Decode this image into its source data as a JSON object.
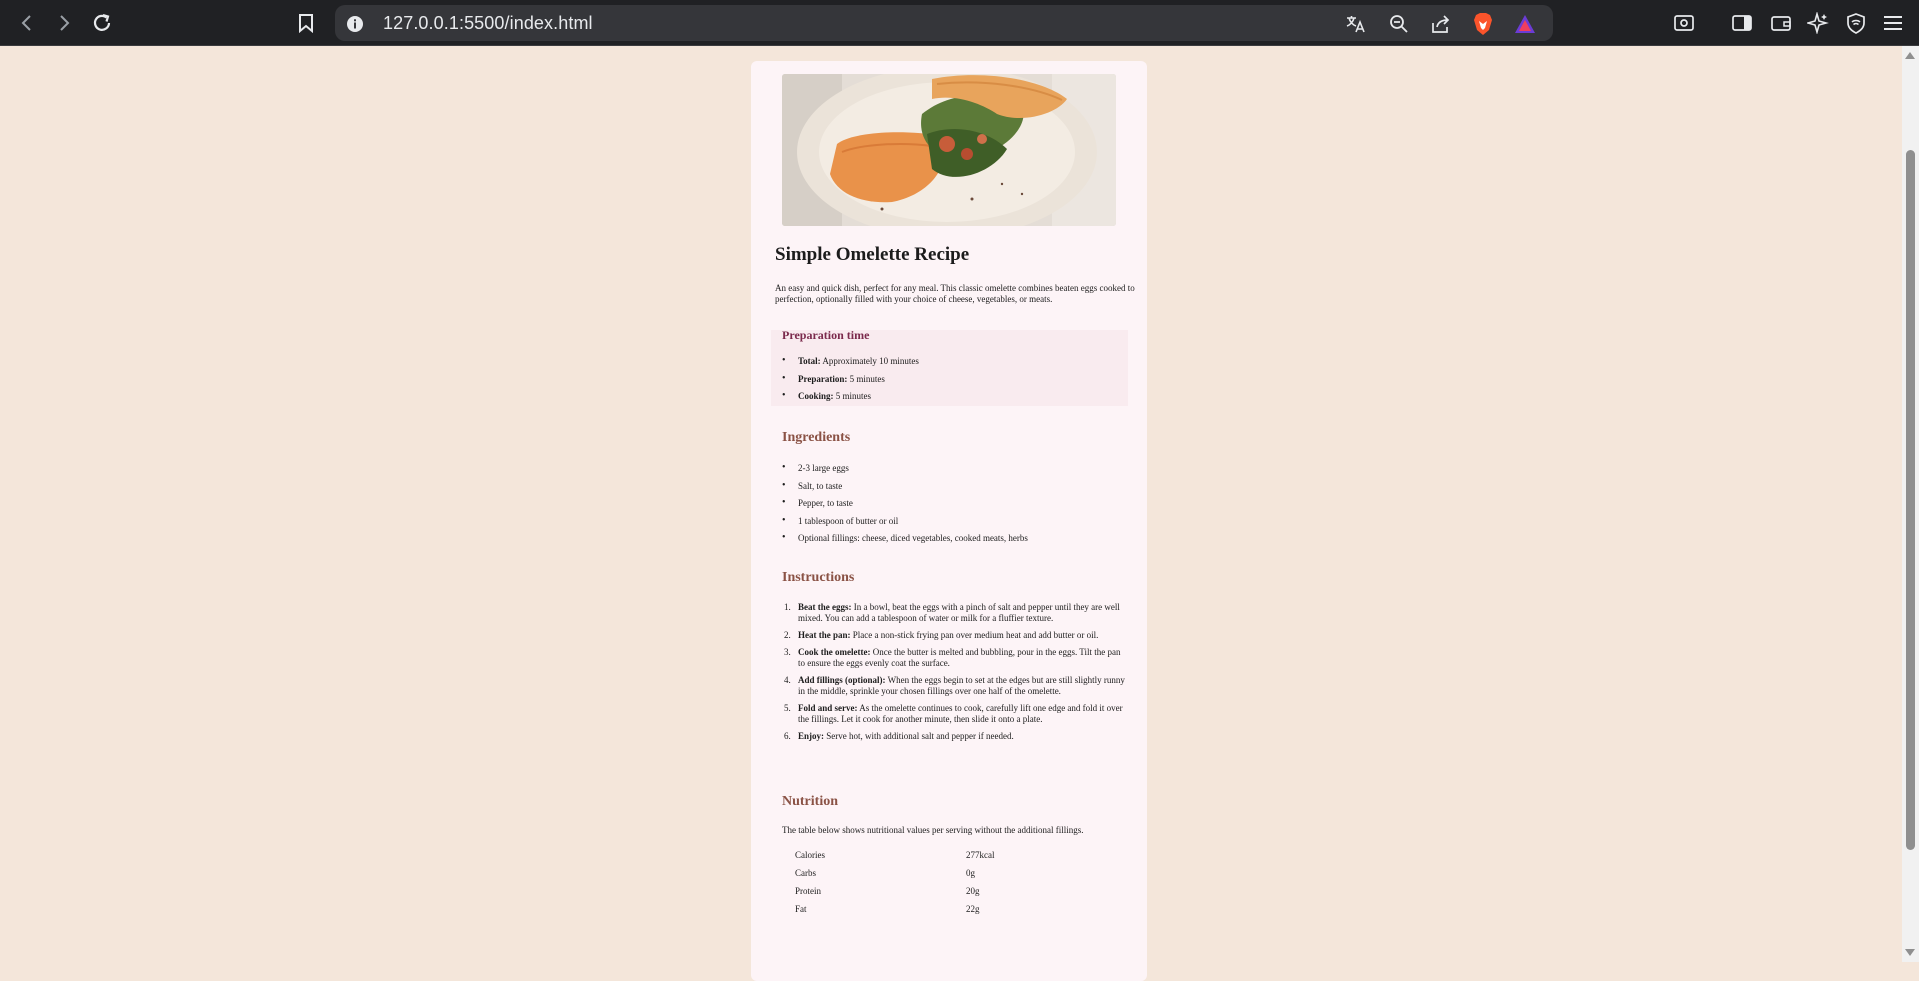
{
  "browser": {
    "url": "127.0.0.1:5500/index.html"
  },
  "recipe": {
    "title": "Simple Omelette Recipe",
    "intro": "An easy and quick dish, perfect for any meal. This classic omelette combines beaten eggs cooked to perfection, optionally filled with your choice of cheese, vegetables, or meats.",
    "prep": {
      "heading": "Preparation time",
      "items": [
        {
          "label": "Total:",
          "value": " Approximately 10 minutes"
        },
        {
          "label": "Preparation:",
          "value": " 5 minutes"
        },
        {
          "label": "Cooking:",
          "value": " 5 minutes"
        }
      ]
    },
    "ingredients": {
      "heading": "Ingredients",
      "items": [
        "2-3 large eggs",
        "Salt, to taste",
        "Pepper, to taste",
        "1 tablespoon of butter or oil",
        "Optional fillings: cheese, diced vegetables, cooked meats, herbs"
      ]
    },
    "instructions": {
      "heading": "Instructions",
      "steps": [
        {
          "num": "1.",
          "label": "Beat the eggs:",
          "text": " In a bowl, beat the eggs with a pinch of salt and pepper until they are well mixed. You can add a tablespoon of water or milk for a fluffier texture."
        },
        {
          "num": "2.",
          "label": "Heat the pan:",
          "text": " Place a non-stick frying pan over medium heat and add butter or oil."
        },
        {
          "num": "3.",
          "label": "Cook the omelette:",
          "text": " Once the butter is melted and bubbling, pour in the eggs. Tilt the pan to ensure the eggs evenly coat the surface."
        },
        {
          "num": "4.",
          "label": "Add fillings (optional):",
          "text": " When the eggs begin to set at the edges but are still slightly runny in the middle, sprinkle your chosen fillings over one half of the omelette."
        },
        {
          "num": "5.",
          "label": "Fold and serve:",
          "text": " As the omelette continues to cook, carefully lift one edge and fold it over the fillings. Let it cook for another minute, then slide it onto a plate."
        },
        {
          "num": "6.",
          "label": "Enjoy:",
          "text": " Serve hot, with additional salt and pepper if needed."
        }
      ]
    },
    "nutrition": {
      "heading": "Nutrition",
      "text": "The table below shows nutritional values per serving without the additional fillings.",
      "rows": [
        {
          "name": "Calories",
          "value": "277kcal"
        },
        {
          "name": "Carbs",
          "value": "0g"
        },
        {
          "name": "Protein",
          "value": "20g"
        },
        {
          "name": "Fat",
          "value": "22g"
        }
      ]
    }
  },
  "icons": {
    "back": "arrow-left-icon",
    "forward": "arrow-right-icon",
    "reload": "reload-icon",
    "bookmark": "bookmark-icon",
    "site_info": "info-icon",
    "translate": "translate-icon",
    "zoom": "zoom-out-icon",
    "share": "share-icon",
    "brave_shields": "brave-lion-icon",
    "rewards": "rewards-triangle-icon",
    "screenshot": "screenshot-icon",
    "sidebar": "sidebar-icon",
    "wallet": "wallet-icon",
    "leo": "sparkle-icon",
    "vpn": "vpn-shield-icon",
    "menu": "hamburger-menu-icon"
  },
  "colors": {
    "page_bg": "#f4e6da",
    "card_bg": "#fdf4f7",
    "prep_bg": "#f9ebef",
    "prep_heading": "#7b2a4c",
    "section_heading": "#8a5245"
  }
}
